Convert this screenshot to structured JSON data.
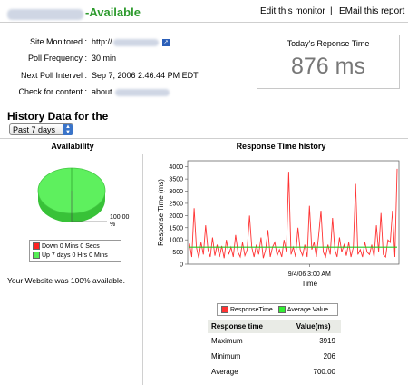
{
  "header": {
    "status": "-Available",
    "edit_link": "Edit this monitor",
    "separator": "|",
    "email_link": "EMail this report"
  },
  "info": {
    "site_label": "Site Monitored :",
    "site_value": "http://",
    "poll_label": "Poll Frequency :",
    "poll_value": "30 min",
    "next_label": "Next Poll Intervel :",
    "next_value": "Sep 7, 2006 2:46:44 PM EDT",
    "check_label": "Check for content :",
    "check_value": "about"
  },
  "response_box": {
    "title": "Today's Reponse Time",
    "value": "876 ms"
  },
  "history": {
    "title": "History Data for the",
    "period_selected": "Past 7 days"
  },
  "availability": {
    "title": "Availability",
    "pie_label_value": "100.00",
    "pie_label_unit": "%",
    "legend_down": "Down 0 Mins 0 Secs",
    "legend_up": "Up 7 days 0 Hrs 0 Mins",
    "summary": "Your Website was 100% available.",
    "colors": {
      "up": "#55ee55",
      "down": "#ff2222"
    }
  },
  "response_history": {
    "title": "Response Time history",
    "legend_series1": "ResponseTime",
    "legend_series2": "Average Value",
    "colors": {
      "response": "#ff3333",
      "average": "#22cc22"
    }
  },
  "stats_table": {
    "headers": [
      "Response time",
      "Value(ms)"
    ],
    "rows": [
      [
        "Maximum",
        "3919"
      ],
      [
        "Minimum",
        "206"
      ],
      [
        "Average",
        "700.00"
      ]
    ]
  },
  "chart_data": [
    {
      "type": "pie",
      "title": "Availability",
      "slices": [
        {
          "label": "Down 0 Mins 0 Secs",
          "value": 0
        },
        {
          "label": "Up 7 days 0 Hrs 0 Mins",
          "value": 100.0
        }
      ]
    },
    {
      "type": "line",
      "title": "Response Time history",
      "xlabel": "Time",
      "ylabel": "Response Time (ms)",
      "ylim": [
        0,
        4250
      ],
      "yticks": [
        0,
        500,
        1000,
        1500,
        2000,
        2500,
        3000,
        3500,
        4000
      ],
      "xticks": [
        "9/4/06 3:00 AM"
      ],
      "grid": false,
      "legend": "bottom",
      "series": [
        {
          "name": "ResponseTime",
          "values": [
            850,
            300,
            2300,
            700,
            250,
            900,
            400,
            1600,
            600,
            300,
            1100,
            350,
            800,
            300,
            750,
            250,
            1000,
            400,
            700,
            300,
            1200,
            500,
            300,
            900,
            350,
            600,
            2000,
            700,
            300,
            800,
            400,
            1100,
            250,
            600,
            1400,
            300,
            700,
            900,
            350,
            600,
            300,
            1000,
            500,
            3800,
            400,
            700,
            300,
            1500,
            600,
            350,
            800,
            300,
            2400,
            600,
            900,
            300,
            1200,
            2200,
            500,
            300,
            800,
            400,
            1900,
            600,
            300,
            1100,
            500,
            800,
            350,
            900,
            300,
            700,
            3300,
            400,
            600,
            300,
            900,
            500,
            400,
            800,
            300,
            1600,
            500,
            2100,
            400,
            300,
            1000,
            900,
            2200,
            300,
            3919
          ]
        },
        {
          "name": "Average Value",
          "values": [
            700,
            700,
            700,
            700,
            700,
            700,
            700,
            700,
            700,
            700,
            700,
            700,
            700,
            700,
            700,
            700,
            700,
            700,
            700,
            700,
            700,
            700,
            700,
            700,
            700,
            700,
            700,
            700,
            700,
            700,
            700,
            700,
            700,
            700,
            700,
            700,
            700,
            700,
            700,
            700,
            700,
            700,
            700,
            700,
            700,
            700,
            700,
            700,
            700,
            700,
            700,
            700,
            700,
            700,
            700,
            700,
            700,
            700,
            700,
            700,
            700,
            700,
            700,
            700,
            700,
            700,
            700,
            700,
            700,
            700,
            700,
            700,
            700,
            700,
            700,
            700,
            700,
            700,
            700,
            700,
            700,
            700,
            700,
            700,
            700,
            700,
            700,
            700,
            700,
            700,
            700
          ]
        }
      ]
    }
  ]
}
